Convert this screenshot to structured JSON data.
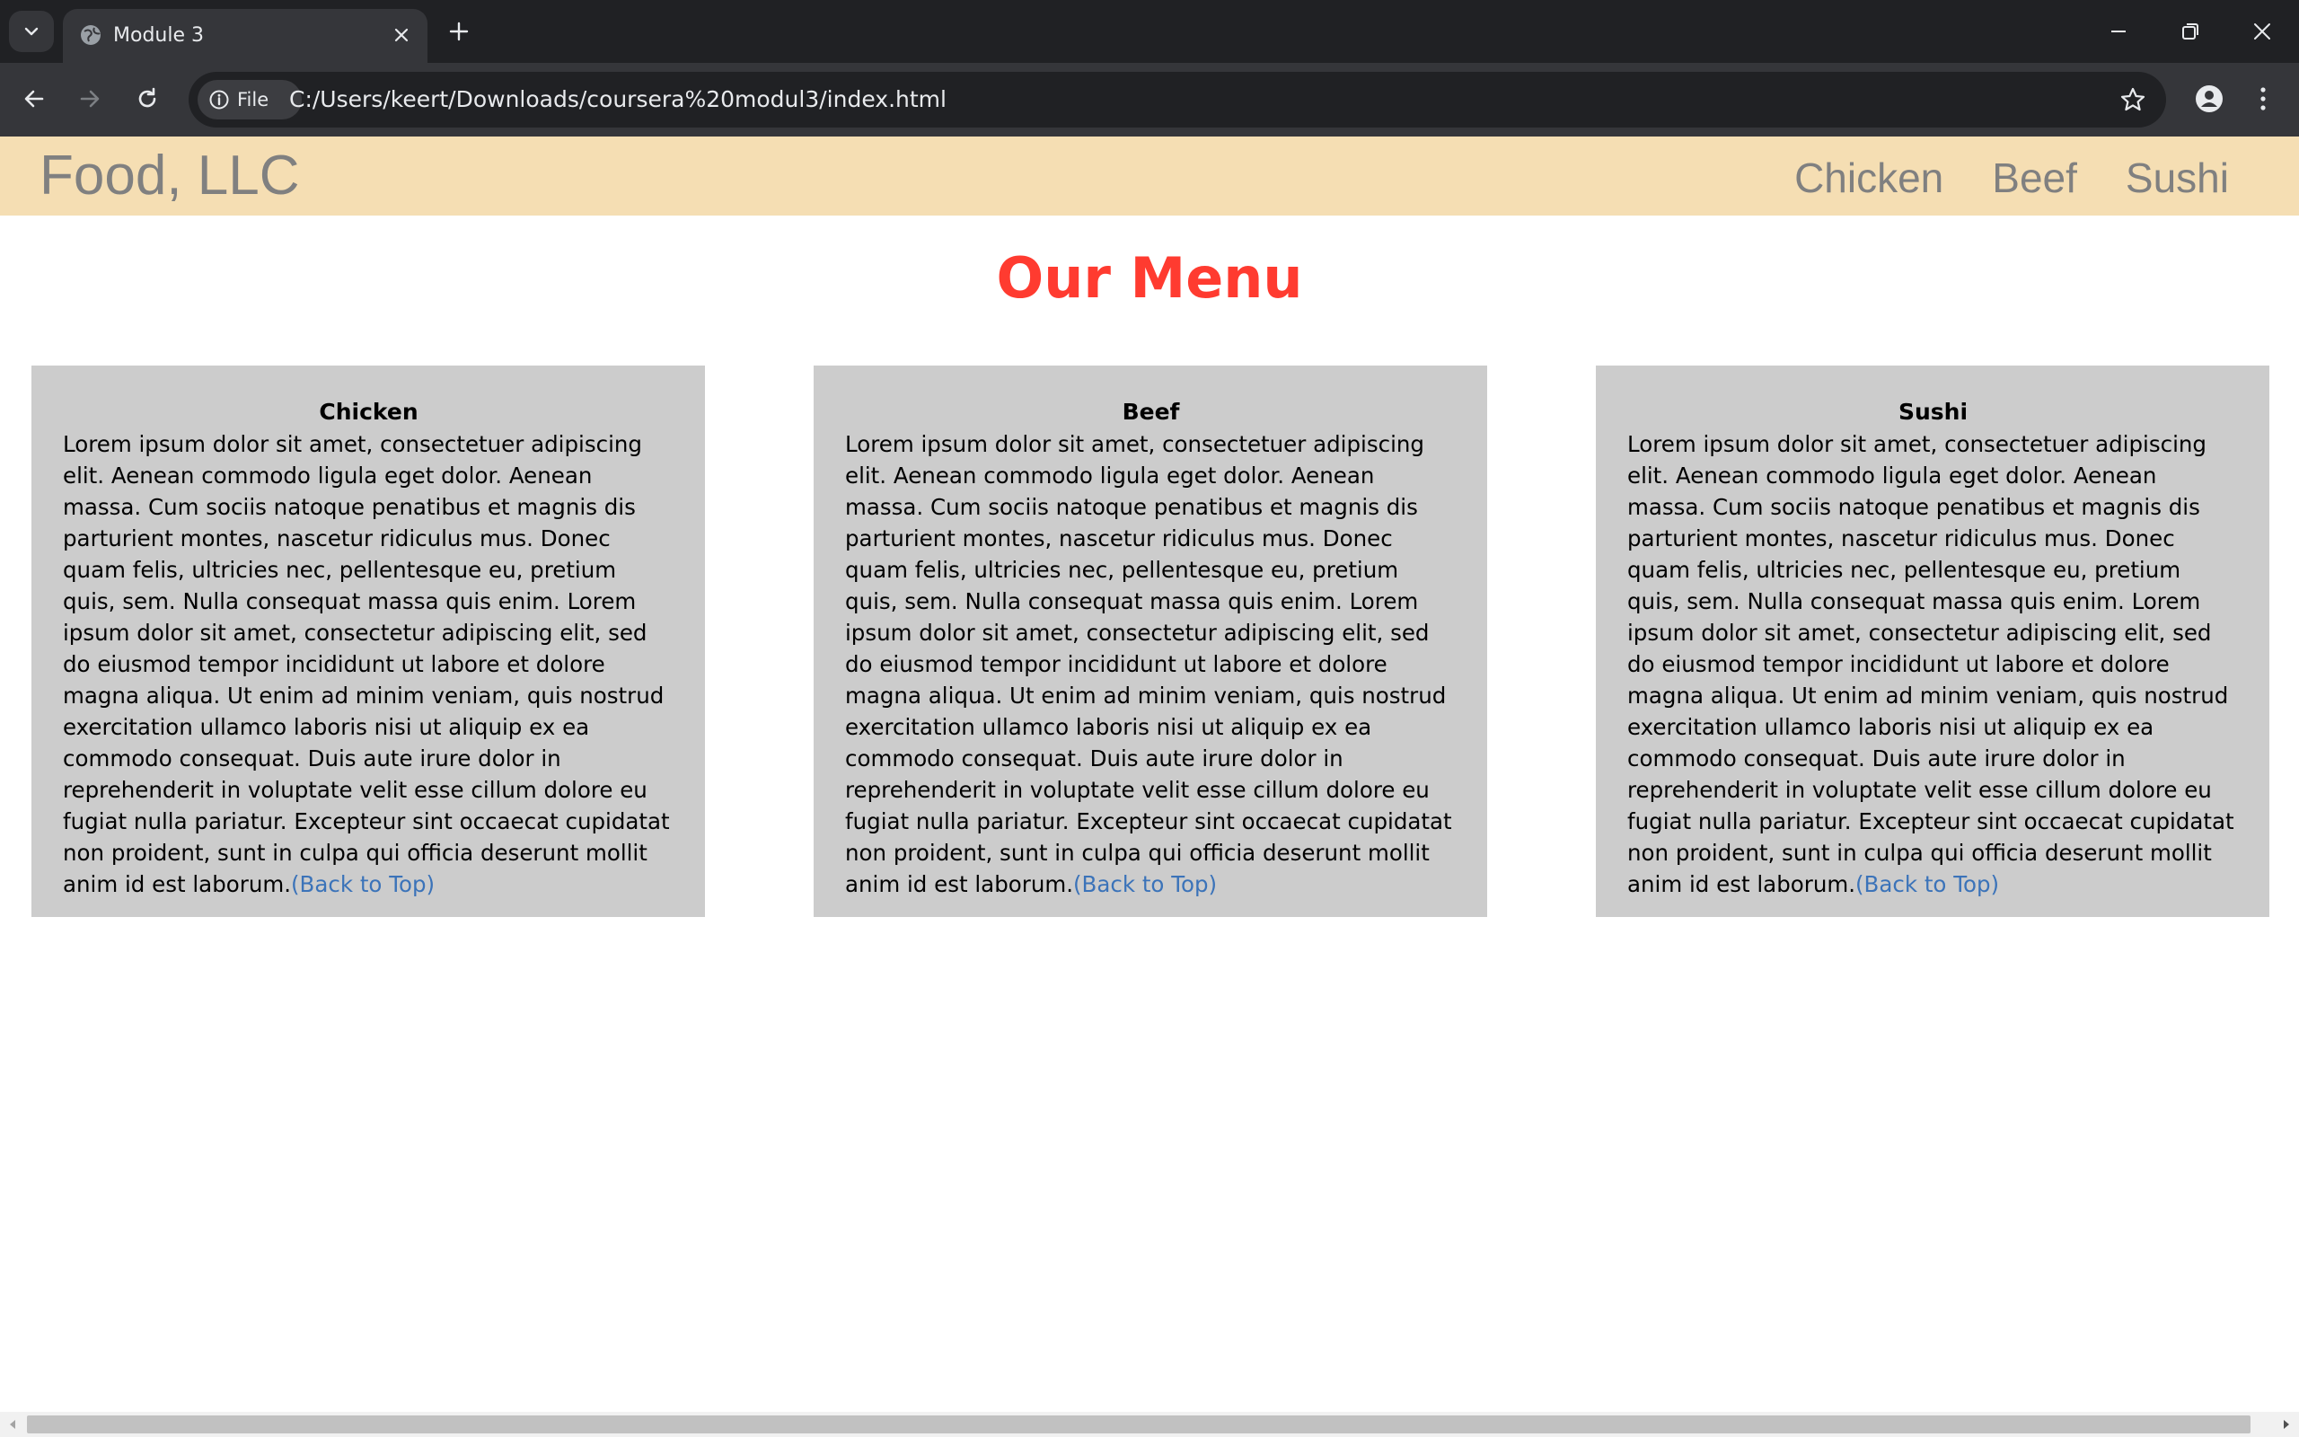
{
  "browser": {
    "tab_title": "Module 3",
    "site_chip_label": "File",
    "url": "C:/Users/keert/Downloads/coursera%20modul3/index.html"
  },
  "page": {
    "brand": "Food, LLC",
    "nav": [
      "Chicken",
      "Beef",
      "Sushi"
    ],
    "heading": "Our Menu",
    "sections": [
      {
        "title": "Chicken",
        "text": "Lorem ipsum dolor sit amet, consectetuer adipiscing elit. Aenean commodo ligula eget dolor. Aenean massa. Cum sociis natoque penatibus et magnis dis parturient montes, nascetur ridiculus mus. Donec quam felis, ultricies nec, pellentesque eu, pretium quis, sem. Nulla consequat massa quis enim. Lorem ipsum dolor sit amet, consectetur adipiscing elit, sed do eiusmod tempor incididunt ut labore et dolore magna aliqua. Ut enim ad minim veniam, quis nostrud exercitation ullamco laboris nisi ut aliquip ex ea commodo consequat. Duis aute irure dolor in reprehenderit in voluptate velit esse cillum dolore eu fugiat nulla pariatur. Excepteur sint occaecat cupidatat non proident, sunt in culpa qui officia deserunt mollit anim id est laborum.",
        "link": "(Back to Top)"
      },
      {
        "title": "Beef",
        "text": "Lorem ipsum dolor sit amet, consectetuer adipiscing elit. Aenean commodo ligula eget dolor. Aenean massa. Cum sociis natoque penatibus et magnis dis parturient montes, nascetur ridiculus mus. Donec quam felis, ultricies nec, pellentesque eu, pretium quis, sem. Nulla consequat massa quis enim. Lorem ipsum dolor sit amet, consectetur adipiscing elit, sed do eiusmod tempor incididunt ut labore et dolore magna aliqua. Ut enim ad minim veniam, quis nostrud exercitation ullamco laboris nisi ut aliquip ex ea commodo consequat. Duis aute irure dolor in reprehenderit in voluptate velit esse cillum dolore eu fugiat nulla pariatur. Excepteur sint occaecat cupidatat non proident, sunt in culpa qui officia deserunt mollit anim id est laborum.",
        "link": "(Back to Top)"
      },
      {
        "title": "Sushi",
        "text": "Lorem ipsum dolor sit amet, consectetuer adipiscing elit. Aenean commodo ligula eget dolor. Aenean massa. Cum sociis natoque penatibus et magnis dis parturient montes, nascetur ridiculus mus. Donec quam felis, ultricies nec, pellentesque eu, pretium quis, sem. Nulla consequat massa quis enim. Lorem ipsum dolor sit amet, consectetur adipiscing elit, sed do eiusmod tempor incididunt ut labore et dolore magna aliqua. Ut enim ad minim veniam, quis nostrud exercitation ullamco laboris nisi ut aliquip ex ea commodo consequat. Duis aute irure dolor in reprehenderit in voluptate velit esse cillum dolore eu fugiat nulla pariatur. Excepteur sint occaecat cupidatat non proident, sunt in culpa qui officia deserunt mollit anim id est laborum.",
        "link": "(Back to Top)"
      }
    ]
  },
  "colors": {
    "header_bg": "#f5deb3",
    "heading": "#ff3b30",
    "card_bg": "#cccccc",
    "link": "#3b73b9",
    "chrome_dark": "#202124",
    "chrome_toolbar": "#35363a"
  },
  "icons": {
    "tab_search": "chevron-down-icon",
    "tab_favicon": "globe-icon",
    "tab_close": "close-icon",
    "new_tab": "plus-icon",
    "minimize": "minimize-icon",
    "restore": "restore-icon",
    "close_window": "close-icon",
    "back": "arrow-left-icon",
    "forward": "arrow-right-icon",
    "reload": "reload-icon",
    "site_info": "info-icon",
    "bookmark": "star-icon",
    "profile": "person-icon",
    "menu": "more-vertical-icon"
  }
}
